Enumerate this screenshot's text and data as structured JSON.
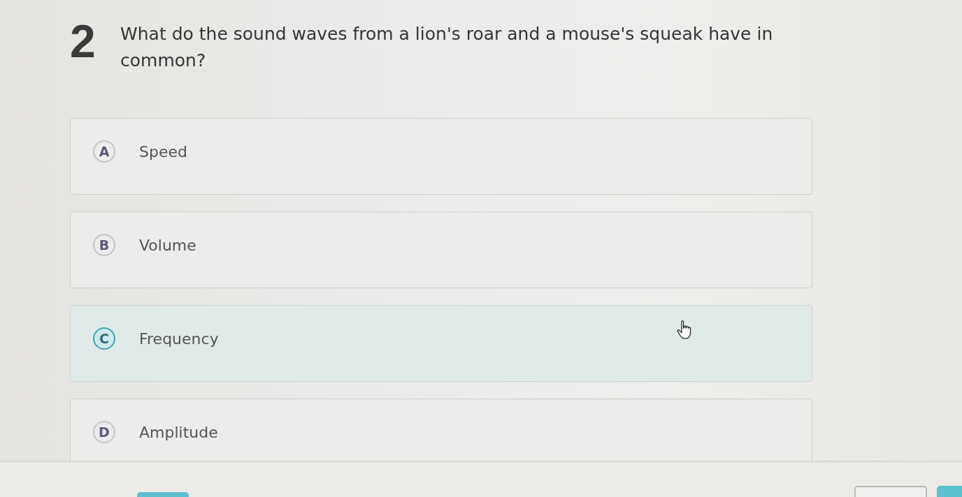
{
  "question": {
    "number": "2",
    "text": "What do the sound waves from a lion's roar and a mouse's squeak have in common?"
  },
  "options": [
    {
      "letter": "A",
      "text": "Speed",
      "hovered": false
    },
    {
      "letter": "B",
      "text": "Volume",
      "hovered": false
    },
    {
      "letter": "C",
      "text": "Frequency",
      "hovered": true
    },
    {
      "letter": "D",
      "text": "Amplitude",
      "hovered": false
    }
  ]
}
